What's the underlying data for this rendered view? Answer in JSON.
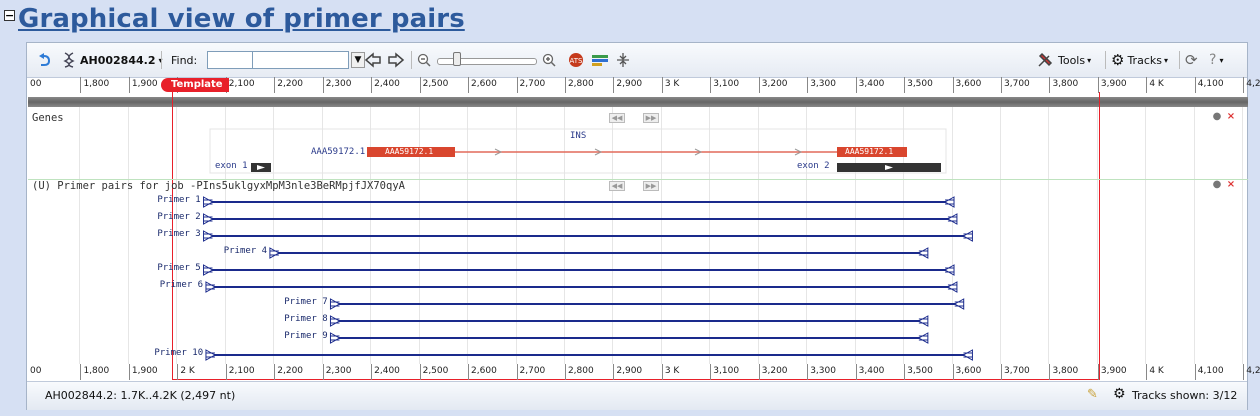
{
  "page": {
    "title": "Graphical view of primer pairs",
    "collapse_symbol": "−"
  },
  "toolbar": {
    "sequence": "AH002844.2",
    "find_label": "Find:",
    "find_value": "",
    "tools_label": "Tools",
    "tracks_label": "Tracks",
    "help_label": "?"
  },
  "ruler": {
    "ticks": [
      "00",
      "1,800",
      "1,900",
      "2,000",
      "2,100",
      "2,200",
      "2,300",
      "2,400",
      "2,500",
      "2,600",
      "2,700",
      "2,800",
      "2,900",
      "3 K",
      "3,100",
      "3,200",
      "3,300",
      "3,400",
      "3,500",
      "3,600",
      "3,700",
      "3,800",
      "3,900",
      "4 K",
      "4,100",
      "4,2"
    ],
    "bottom_ticks": [
      "00",
      "1,800",
      "1,900",
      "2 K",
      "2,100",
      "2,200",
      "2,300",
      "2,400",
      "2,500",
      "2,600",
      "2,700",
      "2,800",
      "2,900",
      "3 K",
      "3,100",
      "3,200",
      "3,300",
      "3,400",
      "3,500",
      "3,600",
      "3,700",
      "3,800",
      "3,900",
      "4 K",
      "4,100",
      "4,2"
    ],
    "template_label": "Template"
  },
  "genes_track": {
    "label": "Genes",
    "gene_name": "INS",
    "feature_label": "AAA59172.1",
    "cds_label_1": "AAA59172.1",
    "cds_label_2": "AAA59172.1",
    "exon1_label": "exon 1",
    "exon2_label": "exon 2"
  },
  "primer_track": {
    "label": "(U) Primer pairs for job -PIns5uklgyxMpM3nle3BeRMpjfJX70qyA",
    "primers": [
      {
        "name": "Primer 1",
        "start": 2103,
        "end": 3652
      },
      {
        "name": "Primer 2",
        "start": 2103,
        "end": 3658
      },
      {
        "name": "Primer 3",
        "start": 2103,
        "end": 3690
      },
      {
        "name": "Primer 4",
        "start": 2240,
        "end": 3598
      },
      {
        "name": "Primer 5",
        "start": 2103,
        "end": 3652
      },
      {
        "name": "Primer 6",
        "start": 2108,
        "end": 3658
      },
      {
        "name": "Primer 7",
        "start": 2365,
        "end": 3672
      },
      {
        "name": "Primer 8",
        "start": 2365,
        "end": 3598
      },
      {
        "name": "Primer 9",
        "start": 2365,
        "end": 3598
      },
      {
        "name": "Primer 10",
        "start": 2108,
        "end": 3690
      }
    ]
  },
  "status": {
    "range": "AH002844.2: 1.7K..4.2K (2,497 nt)",
    "tracks_shown": "Tracks shown: 3/12"
  },
  "colors": {
    "primer": "#1a2a8c",
    "template": "#e8202a",
    "exon": "#d9462e"
  }
}
